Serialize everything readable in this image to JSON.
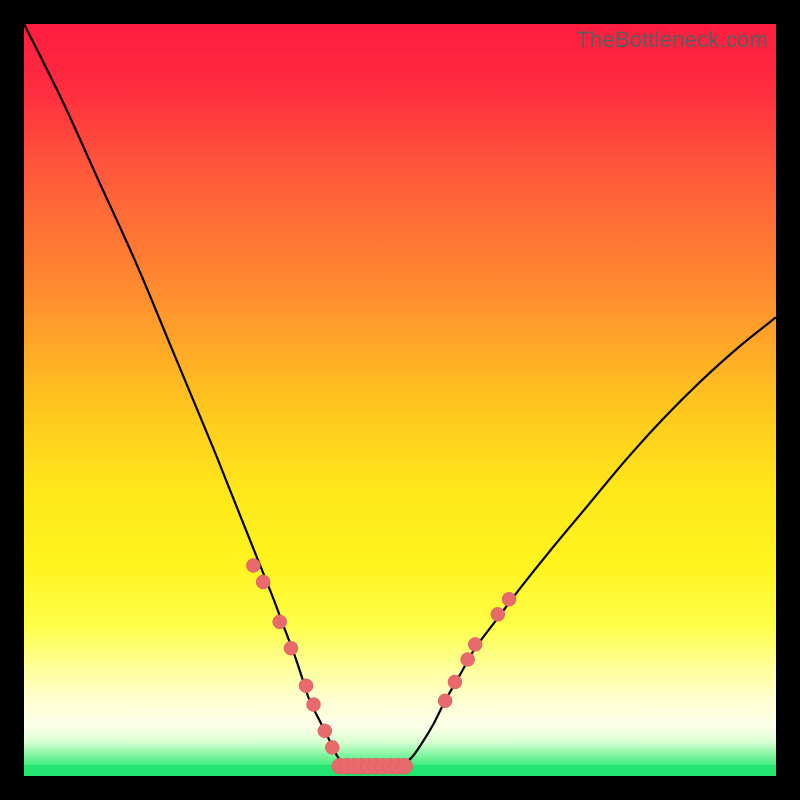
{
  "watermark": "TheBottleneck.com",
  "colors": {
    "frame": "#000000",
    "curve": "#000000",
    "marker_fill": "#e86a6c",
    "marker_stroke": "#d85a5e",
    "bottom_band": "#22e571",
    "gradient_stops": [
      {
        "offset": 0.0,
        "color": "#ff1d3f"
      },
      {
        "offset": 0.08,
        "color": "#ff2a3f"
      },
      {
        "offset": 0.2,
        "color": "#ff5a3a"
      },
      {
        "offset": 0.35,
        "color": "#ff8a30"
      },
      {
        "offset": 0.5,
        "color": "#ffc31f"
      },
      {
        "offset": 0.62,
        "color": "#ffe71a"
      },
      {
        "offset": 0.72,
        "color": "#fff41f"
      },
      {
        "offset": 0.8,
        "color": "#ffff4a"
      },
      {
        "offset": 0.86,
        "color": "#ffffa0"
      },
      {
        "offset": 0.9,
        "color": "#ffffd2"
      },
      {
        "offset": 0.935,
        "color": "#fbffe8"
      },
      {
        "offset": 0.955,
        "color": "#d7ffd0"
      },
      {
        "offset": 0.97,
        "color": "#8cf6a6"
      },
      {
        "offset": 0.985,
        "color": "#44ec80"
      },
      {
        "offset": 1.0,
        "color": "#22e571"
      }
    ]
  },
  "chart_data": {
    "type": "line",
    "title": "",
    "xlabel": "",
    "ylabel": "",
    "x_range": [
      0,
      100
    ],
    "y_range": [
      0,
      100
    ],
    "description": "Bottleneck curve: a deep V-shaped black curve over a vertical red→yellow→green gradient. The minimum (near 0) is a short flat segment around x≈42–50. Salmon-colored dots mark points on both sides of the valley near the bottom.",
    "series": [
      {
        "name": "bottleneck-curve",
        "x": [
          0,
          5,
          10,
          15,
          20,
          25,
          27,
          29,
          31,
          33,
          34.5,
          36,
          37,
          38,
          39.5,
          41,
          42,
          44,
          46,
          48,
          50,
          51.5,
          53,
          54.5,
          56,
          58,
          60,
          63,
          66,
          70,
          75,
          80,
          85,
          90,
          95,
          100
        ],
        "y": [
          100,
          90,
          79,
          68,
          56,
          44,
          39,
          34,
          29,
          24,
          20,
          16,
          13,
          10,
          7,
          4,
          2.2,
          1.4,
          1.2,
          1.2,
          1.4,
          2.4,
          4.5,
          7,
          10,
          13.5,
          17,
          21,
          25,
          30,
          36,
          42,
          47.5,
          52.5,
          57,
          61
        ]
      }
    ],
    "markers": {
      "name": "highlight-dots",
      "points": [
        {
          "x": 30.5,
          "y": 28.0,
          "r": 7
        },
        {
          "x": 31.8,
          "y": 25.8,
          "r": 7
        },
        {
          "x": 34.0,
          "y": 20.5,
          "r": 7
        },
        {
          "x": 35.5,
          "y": 17.0,
          "r": 7
        },
        {
          "x": 37.5,
          "y": 12.0,
          "r": 7
        },
        {
          "x": 38.5,
          "y": 9.5,
          "r": 7
        },
        {
          "x": 40.0,
          "y": 6.0,
          "r": 7
        },
        {
          "x": 41.0,
          "y": 3.8,
          "r": 7
        },
        {
          "x": 56.0,
          "y": 10.0,
          "r": 7
        },
        {
          "x": 57.3,
          "y": 12.5,
          "r": 7
        },
        {
          "x": 59.0,
          "y": 15.5,
          "r": 7
        },
        {
          "x": 60.0,
          "y": 17.5,
          "r": 7
        },
        {
          "x": 63.0,
          "y": 21.5,
          "r": 7
        },
        {
          "x": 64.5,
          "y": 23.5,
          "r": 7
        }
      ],
      "flat_strip": {
        "x0": 42.0,
        "x1": 51.0,
        "y": 1.3,
        "r": 8
      }
    }
  }
}
